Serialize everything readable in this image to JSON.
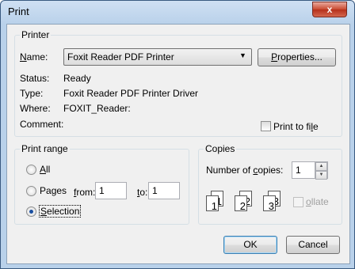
{
  "window": {
    "title": "Print",
    "close_glyph": "x"
  },
  "printer": {
    "group_label": "Printer",
    "name_label": "Name:",
    "name_value": "Foxit Reader PDF Printer",
    "properties_button": "Properties...",
    "status_label": "Status:",
    "status_value": "Ready",
    "type_label": "Type:",
    "type_value": "Foxit Reader PDF Printer Driver",
    "where_label": "Where:",
    "where_value": "FOXIT_Reader:",
    "comment_label": "Comment:",
    "comment_value": "",
    "print_to_file_label": "Print to file",
    "print_to_file_checked": false
  },
  "print_range": {
    "group_label": "Print range",
    "all_label": "All",
    "pages_label": "Pages",
    "from_label": "from:",
    "from_value": "1",
    "to_label": "to:",
    "to_value": "1",
    "selection_label": "Selection",
    "selected": "Selection"
  },
  "copies": {
    "group_label": "Copies",
    "number_label": "Number of copies:",
    "number_value": "1",
    "collate_label": "Collate",
    "collate_checked": false,
    "collate_pages": [
      "1",
      "1",
      "2",
      "2",
      "3",
      "3"
    ]
  },
  "buttons": {
    "ok": "OK",
    "cancel": "Cancel"
  }
}
